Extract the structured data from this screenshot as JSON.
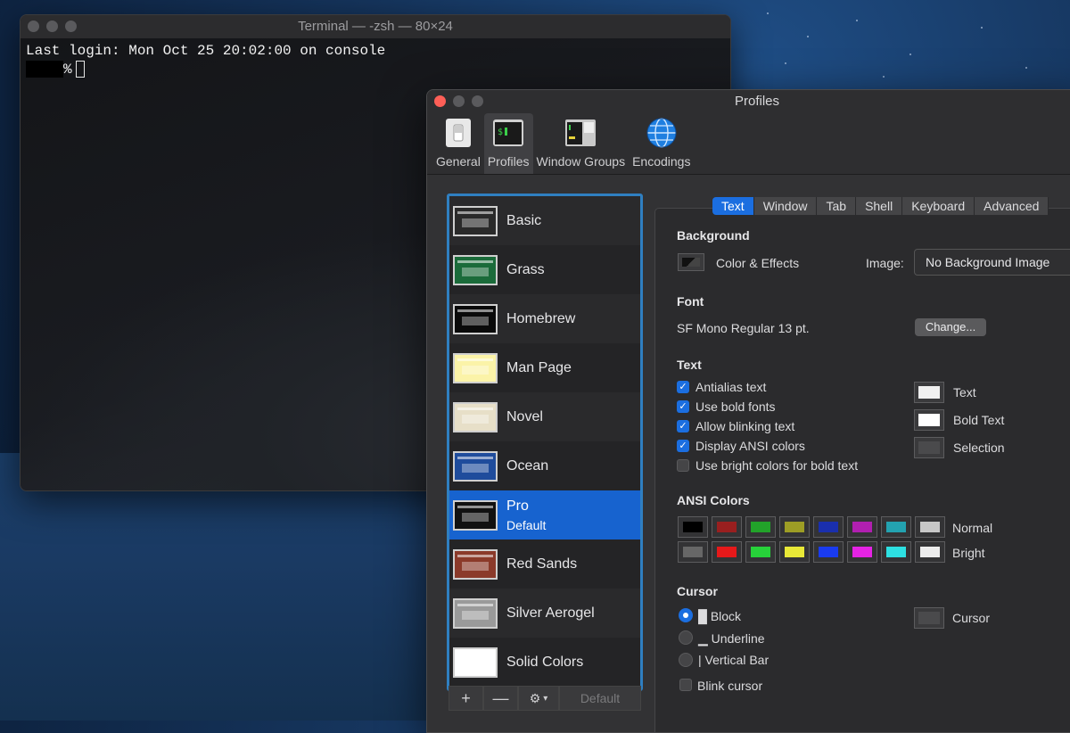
{
  "terminal": {
    "title": "Terminal — -zsh — 80×24",
    "line1": "Last login: Mon Oct 25 20:02:00 on console",
    "prompt": "%"
  },
  "prefs": {
    "title": "Profiles",
    "toolbar": [
      {
        "label": "General",
        "icon": "general-switch-icon"
      },
      {
        "label": "Profiles",
        "icon": "terminal-profiles-icon"
      },
      {
        "label": "Window Groups",
        "icon": "window-groups-icon"
      },
      {
        "label": "Encodings",
        "icon": "globe-icon"
      }
    ],
    "profiles": [
      {
        "name": "Basic",
        "thumb": "#2a2a2a"
      },
      {
        "name": "Grass",
        "thumb": "#1b6b3a"
      },
      {
        "name": "Homebrew",
        "thumb": "#0a0a0a"
      },
      {
        "name": "Man Page",
        "thumb": "#fbf3a8"
      },
      {
        "name": "Novel",
        "thumb": "#e7dfc8"
      },
      {
        "name": "Ocean",
        "thumb": "#1f4c9c"
      },
      {
        "name": "Pro",
        "sub": "Default",
        "thumb": "#111111",
        "selected": true
      },
      {
        "name": "Red Sands",
        "thumb": "#8b3a2a"
      },
      {
        "name": "Silver Aerogel",
        "thumb": "#9a9a9a"
      },
      {
        "name": "Solid Colors",
        "thumb": "#ffffff"
      }
    ],
    "list_buttons": {
      "add": "+",
      "remove": "—",
      "default": "Default"
    },
    "tabs": [
      "Text",
      "Window",
      "Tab",
      "Shell",
      "Keyboard",
      "Advanced"
    ],
    "background": {
      "heading": "Background",
      "color_effects": "Color & Effects",
      "image_label": "Image:",
      "image_value": "No Background Image"
    },
    "font": {
      "heading": "Font",
      "value": "SF Mono Regular 13 pt.",
      "change": "Change..."
    },
    "text": {
      "heading": "Text",
      "options": [
        {
          "label": "Antialias text",
          "checked": true
        },
        {
          "label": "Use bold fonts",
          "checked": true
        },
        {
          "label": "Allow blinking text",
          "checked": true
        },
        {
          "label": "Display ANSI colors",
          "checked": true
        },
        {
          "label": "Use bright colors for bold text",
          "checked": false
        }
      ],
      "colors": [
        {
          "label": "Text",
          "color": "#f0f0f0"
        },
        {
          "label": "Bold Text",
          "color": "#ffffff"
        },
        {
          "label": "Selection",
          "color": "#4a4a4c"
        }
      ]
    },
    "ansi": {
      "heading": "ANSI Colors",
      "normal_label": "Normal",
      "bright_label": "Bright",
      "normal": [
        "#000000",
        "#991f1f",
        "#22a32a",
        "#9d9d25",
        "#1a2fad",
        "#b11fb0",
        "#23a2b0",
        "#c7c7c7"
      ],
      "bright": [
        "#676767",
        "#e6191a",
        "#27d23a",
        "#e8e837",
        "#1a3bf0",
        "#e523e4",
        "#2de0e2",
        "#ececec"
      ]
    },
    "cursor": {
      "heading": "Cursor",
      "options": [
        {
          "label": "Block",
          "glyph": "█",
          "selected": true
        },
        {
          "label": "Underline",
          "glyph": "▁",
          "selected": false
        },
        {
          "label": "Vertical Bar",
          "glyph": "|",
          "selected": false
        }
      ],
      "blink": "Blink cursor",
      "color_label": "Cursor",
      "color": "#4a4a4c"
    }
  }
}
